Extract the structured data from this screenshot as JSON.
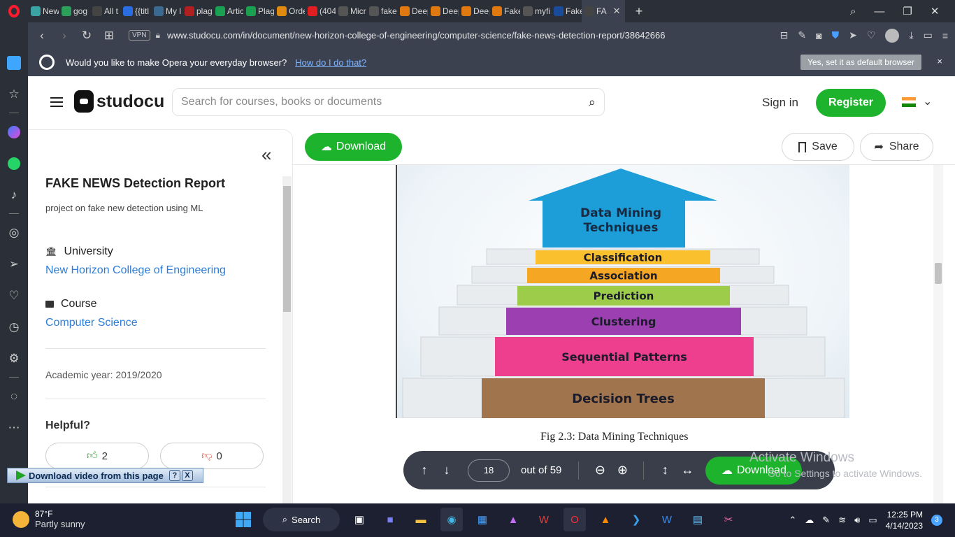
{
  "browser": {
    "tabs": [
      {
        "label": "New",
        "icon": "globe-icon",
        "color": "#3aa3a3"
      },
      {
        "label": "gog",
        "icon": "tv-icon",
        "color": "#2aa05a"
      },
      {
        "label": "All t",
        "icon": "bag-icon",
        "color": "#444"
      },
      {
        "label": "{{titl",
        "icon": "x-icon",
        "color": "#2a6de0"
      },
      {
        "label": "My l",
        "icon": "doc-icon",
        "color": "#3a6a90"
      },
      {
        "label": "plag",
        "icon": "topaz-icon",
        "color": "#b02020"
      },
      {
        "label": "Artic",
        "icon": "p-icon",
        "color": "#1aa050"
      },
      {
        "label": "Plag",
        "icon": "p-icon",
        "color": "#1aa050"
      },
      {
        "label": "Orde",
        "icon": "star-icon",
        "color": "#e08a10"
      },
      {
        "label": "(404",
        "icon": "youtube-icon",
        "color": "#e02020"
      },
      {
        "label": "Micr",
        "icon": "github-icon",
        "color": "#555"
      },
      {
        "label": "fake",
        "icon": "mendeley-icon",
        "color": "#555"
      },
      {
        "label": "Deep",
        "icon": "e-icon",
        "color": "#e07a10"
      },
      {
        "label": "Deep",
        "icon": "e-icon",
        "color": "#e07a10"
      },
      {
        "label": "Deep",
        "icon": "e-icon",
        "color": "#e07a10"
      },
      {
        "label": "Fake",
        "icon": "e-icon",
        "color": "#e07a10"
      },
      {
        "label": "myfi",
        "icon": "github-icon",
        "color": "#555"
      },
      {
        "label": "Fake",
        "icon": "ieee-icon",
        "color": "#1a4a9a"
      },
      {
        "label": "FA",
        "icon": "studocu-icon",
        "color": "#444"
      }
    ],
    "url": "www.studocu.com/in/document/new-horizon-college-of-engineering/computer-science/fake-news-detection-report/38642666",
    "vpn_label": "VPN"
  },
  "infobar": {
    "message": "Would you like to make Opera your everyday browser?",
    "link": "How do I do that?",
    "button": "Yes, set it as default browser",
    "close": "×"
  },
  "header": {
    "logo": "studocu",
    "search_placeholder": "Search for courses, books or documents",
    "signin": "Sign in",
    "register": "Register"
  },
  "left_panel": {
    "collapse": "«",
    "title": "FAKE NEWS Detection Report",
    "description": "project on fake new detection using ML",
    "university_label": "University",
    "university": "New Horizon College of Engineering",
    "course_label": "Course",
    "course": "Computer Science",
    "academic_year_label": "Academic year:",
    "academic_year": "2019/2020",
    "helpful_label": "Helpful?",
    "upvotes": "2",
    "downvotes": "0"
  },
  "toolbar": {
    "download": "Download",
    "save": "Save",
    "share": "Share"
  },
  "figure": {
    "arrow_text_1": "Data Mining",
    "arrow_text_2": "Techniques",
    "steps": [
      {
        "label": "Classification",
        "color": "#fbc02d"
      },
      {
        "label": "Association",
        "color": "#f5a623"
      },
      {
        "label": "Prediction",
        "color": "#9ccc4a"
      },
      {
        "label": "Clustering",
        "color": "#9c3fb0"
      },
      {
        "label": "Sequential Patterns",
        "color": "#ee3f8f"
      },
      {
        "label": "Decision Trees",
        "color": "#a0754e"
      }
    ],
    "caption": "Fig 2.3: Data Mining Techniques"
  },
  "viewer_controls": {
    "page": "18",
    "out_of": "out of 59",
    "download": "Download"
  },
  "watermark": {
    "line1": "Activate Windows",
    "line2": "Go to Settings to activate Windows."
  },
  "video_bar": {
    "label": "Download video from this page",
    "help": "?",
    "close": "X"
  },
  "taskbar": {
    "temperature": "87°F",
    "weather": "Partly sunny",
    "search": "Search",
    "time": "12:25 PM",
    "date": "4/14/2023",
    "notifications": "3"
  }
}
